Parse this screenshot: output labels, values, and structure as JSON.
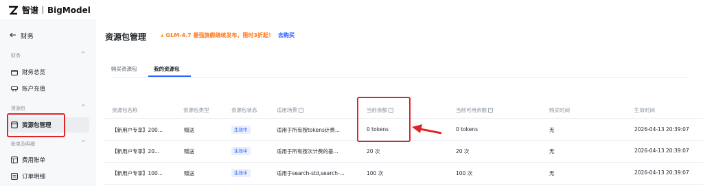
{
  "brand": {
    "cn": "智谱",
    "en": "BigModel"
  },
  "sidebar": {
    "back_label": "财务",
    "groups": [
      {
        "title": "财务",
        "items": [
          {
            "label": "财务总览",
            "icon": "folder-icon"
          },
          {
            "label": "账户充值",
            "icon": "wallet-icon"
          }
        ]
      },
      {
        "title": "资源包",
        "items": [
          {
            "label": "资源包管理",
            "icon": "package-icon"
          }
        ]
      },
      {
        "title": "账单及明细",
        "items": [
          {
            "label": "费用账单",
            "icon": "bill-icon"
          },
          {
            "label": "订单明细",
            "icon": "order-icon"
          }
        ]
      }
    ]
  },
  "main": {
    "title": "资源包管理",
    "promo": {
      "text": "GLM-4.7 最强旗舰继续发布，限时3折起！",
      "link": "去购买",
      "color": "#ff7a1a",
      "link_color": "#2a60ff"
    },
    "tabs": [
      {
        "label": "购买资源包"
      },
      {
        "label": "我的资源包"
      }
    ],
    "table": {
      "headers": [
        "资源包名称",
        "资源包类型",
        "资源包状态",
        "适用场景",
        "当前余额",
        "当前可用余额",
        "购买时间",
        "生效时间"
      ],
      "rows": [
        {
          "name": "【新用户专享】200...",
          "type": "赠送",
          "status": "生效中",
          "scene": "适用于所有按tokens计费...",
          "balance": "0 tokens",
          "available": "0 tokens",
          "purchase_time": "无",
          "effective_time": "2026-04-13 20:39:07"
        },
        {
          "name": "【新用户专享】20...",
          "type": "赠送",
          "status": "生效中",
          "scene": "适用于所有按次计费的基...",
          "balance": "20 次",
          "available": "20 次",
          "purchase_time": "无",
          "effective_time": "2026-04-13 20:39:07"
        },
        {
          "name": "【新用户专享】100...",
          "type": "赠送",
          "status": "生效中",
          "scene": "适用于search-std,search-...",
          "balance": "100 次",
          "available": "100 次",
          "purchase_time": "无",
          "effective_time": "2026-04-13 20:39:07"
        }
      ]
    }
  },
  "colors": {
    "accent": "#2a60ff",
    "highlight": "#e02424",
    "sidebar_bg": "#f7f8fa"
  }
}
